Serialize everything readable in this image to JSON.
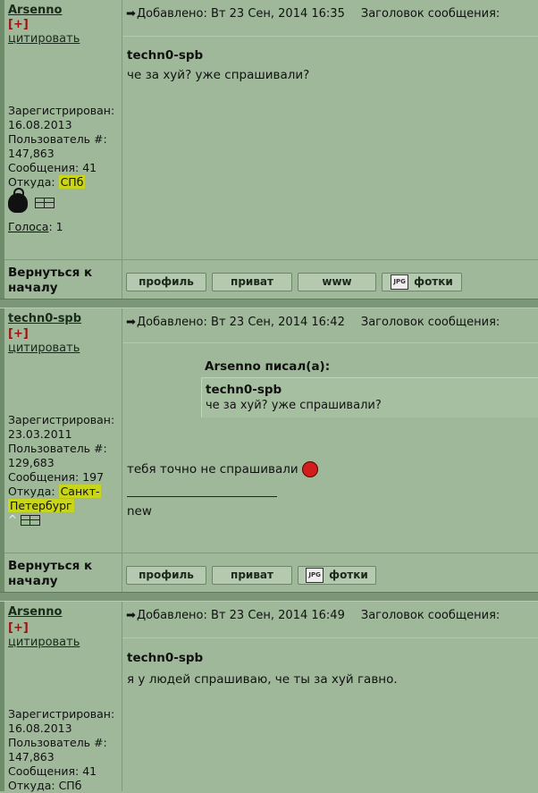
{
  "posts": [
    {
      "author": "Arsenno",
      "plus": "[+]",
      "quote": "цитировать",
      "registered_label": "Зарегистрирован:",
      "registered": "16.08.2013",
      "user_label": "Пользователь #:",
      "user_no": "147,863",
      "messages_label": "Сообщения:",
      "messages": "41",
      "from_label": "Откуда:",
      "from": "СПб",
      "votes_label": "Голоса",
      "votes": ": 1",
      "added": "Добавлено: Вт 23 Сен, 2014 16:35",
      "subject_label": "Заголовок сообщения:",
      "body_author": "techn0-spb",
      "body": "че за хуй? уже спрашивали?"
    },
    {
      "author": "techn0-spb",
      "plus": "[+]",
      "quote": "цитировать",
      "registered_label": "Зарегистрирован:",
      "registered": "23.03.2011",
      "user_label": "Пользователь #:",
      "user_no": "129,683",
      "messages_label": "Сообщения:",
      "messages": "197",
      "from_label": "Откуда:",
      "from": "Санкт-",
      "from2": "Петербург",
      "added": "Добавлено: Вт 23 Сен, 2014 16:42",
      "subject_label": "Заголовок сообщения:",
      "quote_head": "Arsenno писал(а):",
      "quote_author": "techn0-spb",
      "quote_text": "че за хуй? уже спрашивали?",
      "body": "тебя точно не спрашивали",
      "signature": "new"
    },
    {
      "author": "Arsenno",
      "plus": "[+]",
      "quote": "цитировать",
      "registered_label": "Зарегистрирован:",
      "registered": "16.08.2013",
      "user_label": "Пользователь #:",
      "user_no": "147,863",
      "messages_label": "Сообщения:",
      "messages": "41",
      "from_label": "Откуда:",
      "from": "СПб",
      "added": "Добавлено: Вт 23 Сен, 2014 16:49",
      "subject_label": "Заголовок сообщения:",
      "body_author": "techn0-spb",
      "body": "я у людей спрашиваю, че ты за хуй гавно."
    }
  ],
  "footer": {
    "back_line1": "Вернуться к",
    "back_line2": "началу",
    "profile": "профиль",
    "private": "приват",
    "www": "www",
    "photos": "фотки",
    "photo_icon_text": "JPG"
  },
  "icons": {
    "arrow": "➡",
    "highlight_color": "#c8d51a"
  }
}
